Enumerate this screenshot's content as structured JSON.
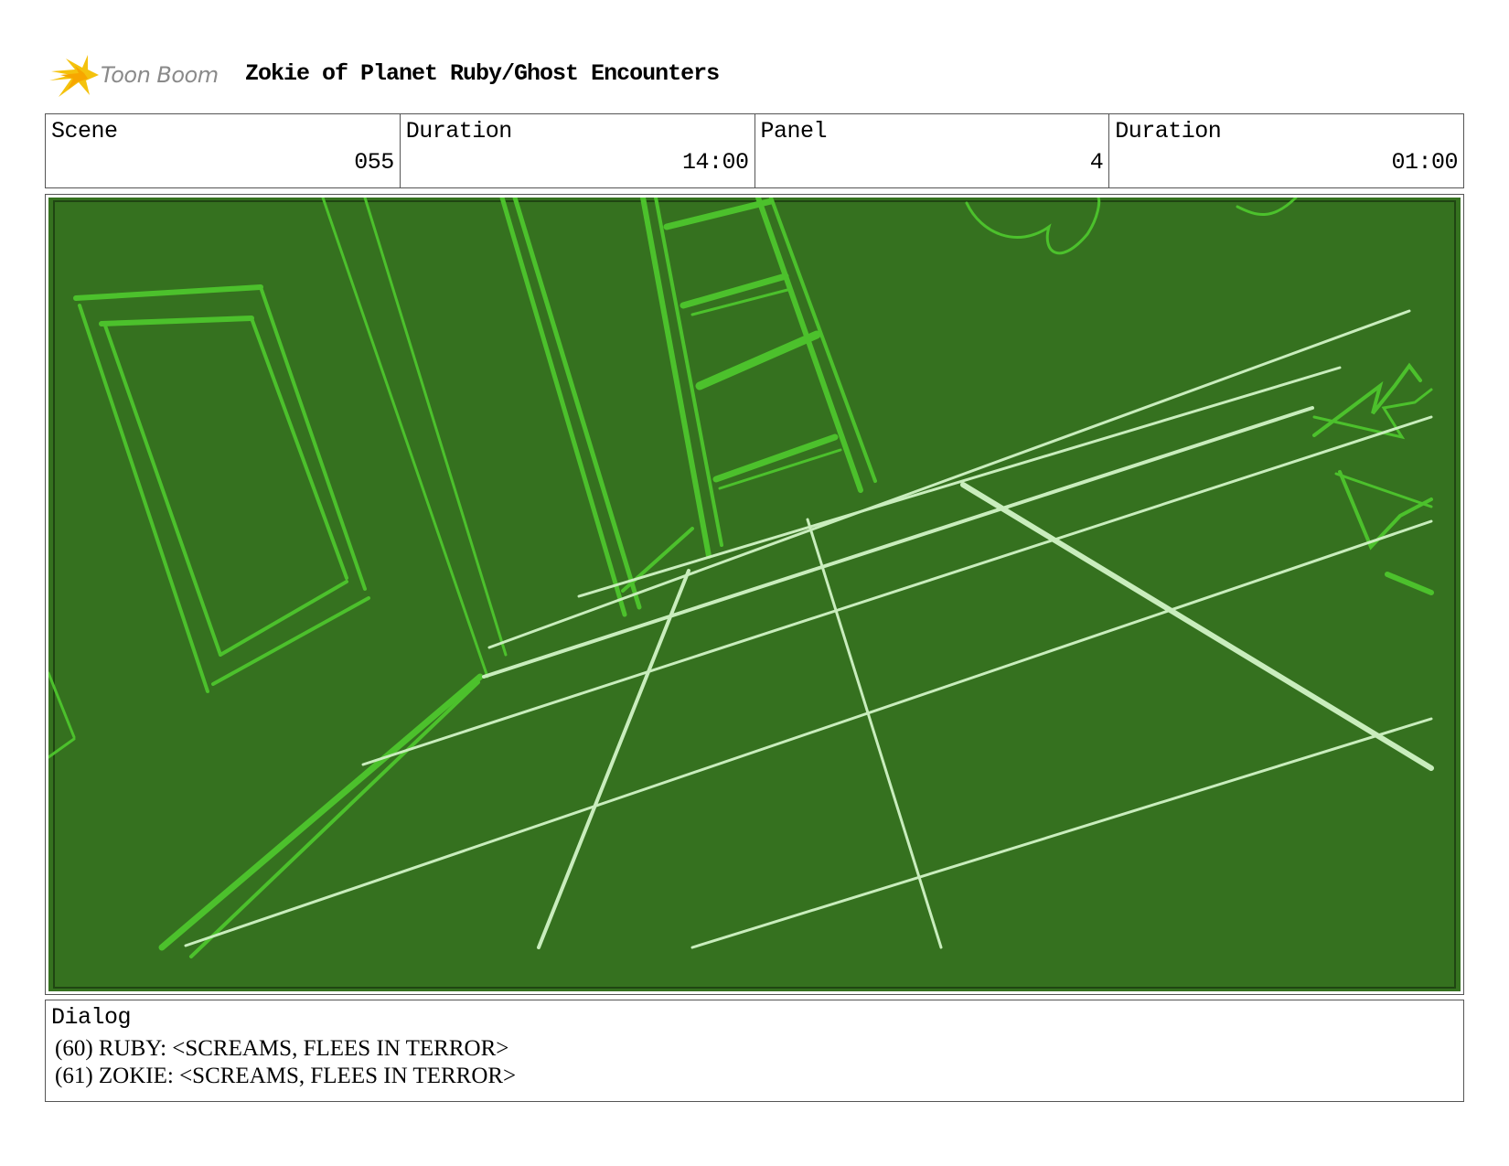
{
  "header": {
    "logo_text": "Toon Boom",
    "title": "Zokie of Planet Ruby/Ghost Encounters"
  },
  "info": {
    "scene_label": "Scene",
    "scene_value": "055",
    "scene_duration_label": "Duration",
    "scene_duration_value": "14:00",
    "panel_label": "Panel",
    "panel_value": "4",
    "panel_duration_label": "Duration",
    "panel_duration_value": "01:00"
  },
  "dialog": {
    "label": "Dialog",
    "lines": [
      "(60) RUBY: <SCREAMS, FLEES IN TERROR>",
      "(61) ZOKIE: <SCREAMS, FLEES IN TERROR>"
    ]
  },
  "colors": {
    "panel_bg": "#35711f",
    "sketch_line": "#4cc12c",
    "floor_line": "#c9edbd"
  }
}
